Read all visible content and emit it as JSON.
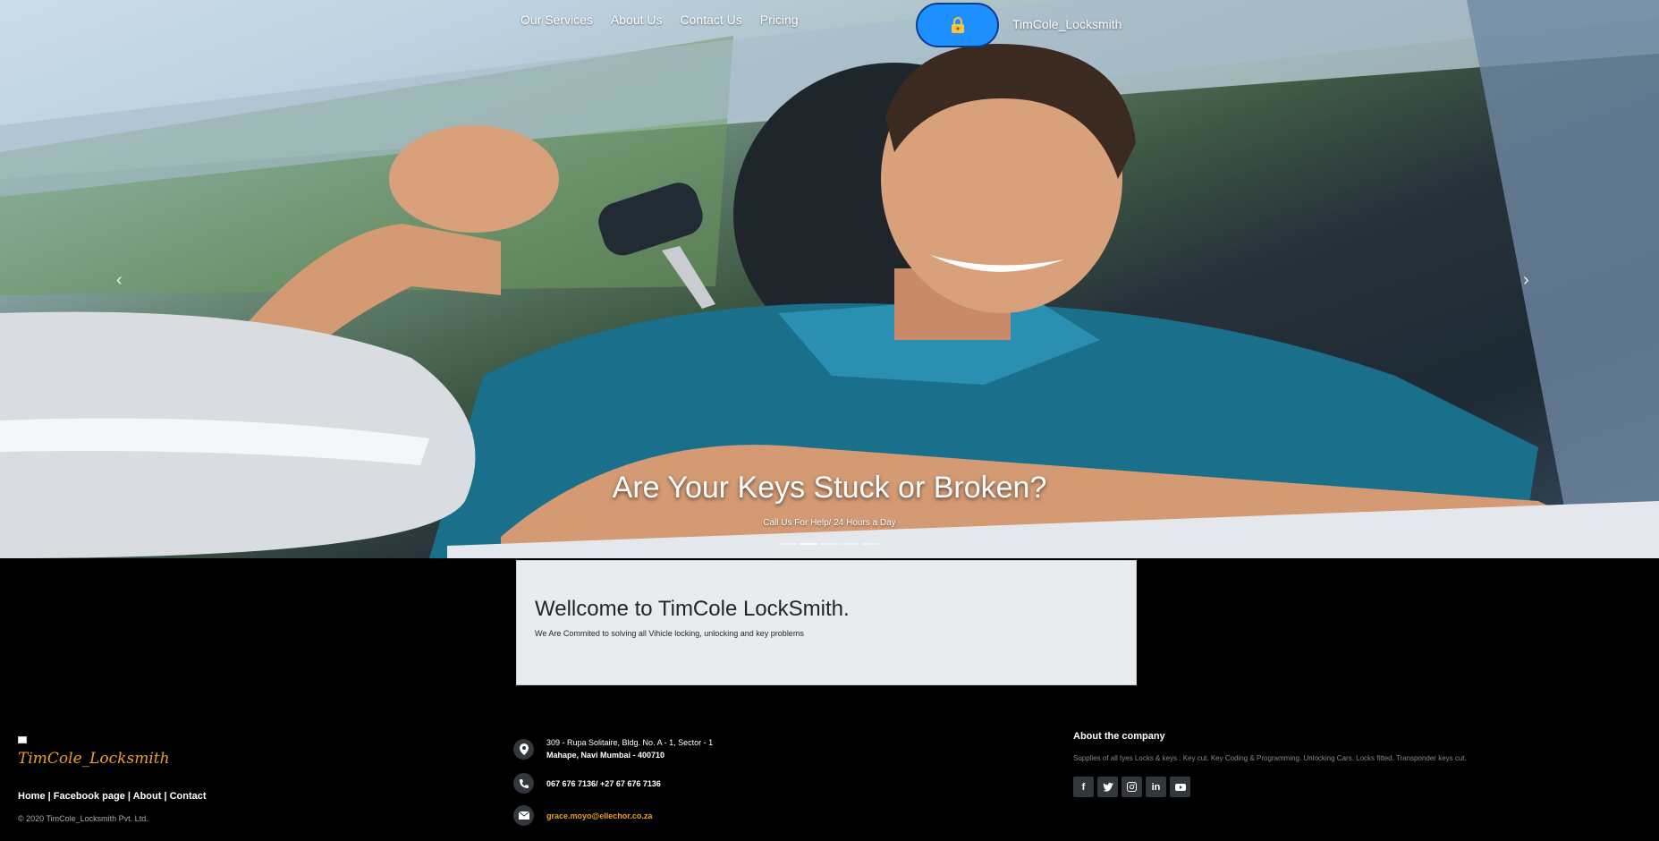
{
  "nav": {
    "items": [
      "Our Services",
      "About Us",
      "Contact Us",
      "Pricing"
    ],
    "brand_name": "TimCole_Locksmith",
    "brand_icon": "padlock-icon"
  },
  "carousel": {
    "title": "Are Your Keys Stuck or Broken?",
    "subtitle": "Call Us For Help/ 24 Hours a Day",
    "prev_icon": "chevron-left-icon",
    "next_icon": "chevron-right-icon",
    "indicator_count": 5,
    "active_indicator": 2
  },
  "welcome": {
    "title": "Wellcome to TimCole LockSmith.",
    "text": "We Are Commited to solving all Vihicle locking, unlocking and key problems"
  },
  "footer": {
    "logo_text": "TimCole_Locksmith",
    "links": [
      "Home",
      "Facebook page",
      "About",
      "Contact"
    ],
    "copyright": "© 2020 TimCole_Locksmith Pvt. Ltd.",
    "address_line1": "309 - Rupa Solitaire, Bldg. No. A - 1, Sector - 1",
    "address_line2": "Mahape, Navi Mumbai - 400710",
    "phone": "067 676 7136/ +27 67 676 7136",
    "email": "grace.moyo@ellechor.co.za",
    "about_title": "About the company",
    "about_text": "Supplies of all tyes Locks & keys : Key cut. Key Coding & Programming. Unlocking Cars. Locks fitted. Transponder keys cut.",
    "socials": [
      "facebook-icon",
      "twitter-icon",
      "instagram-icon",
      "linkedin-icon",
      "youtube-icon"
    ]
  },
  "colors": {
    "accent": "#f0a020",
    "brand_button": "#1e90ff",
    "welcome_bg": "#e9ecef",
    "footer_bg": "#000000"
  }
}
